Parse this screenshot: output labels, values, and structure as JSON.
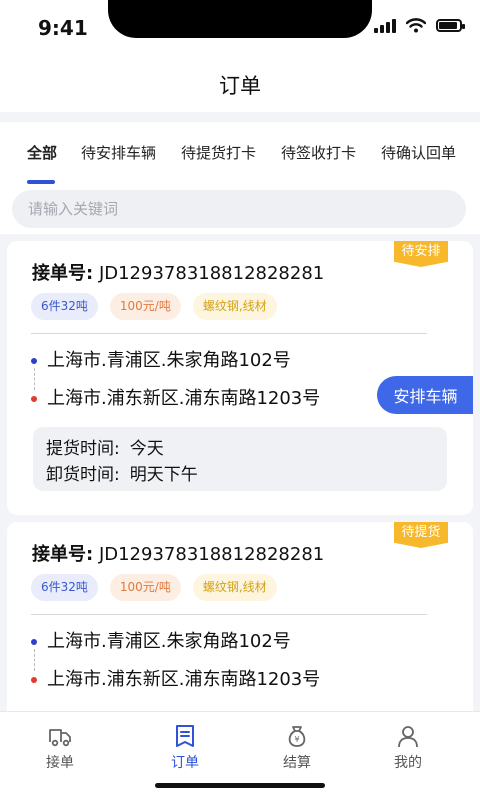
{
  "status_bar": {
    "time": "9:41"
  },
  "header": {
    "title": "订单"
  },
  "tabs": [
    {
      "label": "全部",
      "active": true
    },
    {
      "label": "待安排车辆",
      "active": false
    },
    {
      "label": "待提货打卡",
      "active": false
    },
    {
      "label": "待签收打卡",
      "active": false
    },
    {
      "label": "待确认回单",
      "active": false
    }
  ],
  "search": {
    "placeholder": "请输入关键词",
    "value": ""
  },
  "orders": [
    {
      "status": "待安排",
      "order_label": "接单号:",
      "order_no": "JD129378318812828281",
      "tags": {
        "quantity": "6件32吨",
        "price": "100元/吨",
        "cargo": "螺纹钢,线材"
      },
      "from": "上海市.青浦区.朱家角路102号",
      "to": "上海市.浦东新区.浦东南路1203号",
      "pickup_label": "提货时间:",
      "pickup_value": "今天",
      "unload_label": "卸货时间:",
      "unload_value": "明天下午",
      "action": "安排车辆"
    },
    {
      "status": "待提货",
      "order_label": "接单号:",
      "order_no": "JD129378318812828281",
      "tags": {
        "quantity": "6件32吨",
        "price": "100元/吨",
        "cargo": "螺纹钢,线材"
      },
      "from": "上海市.青浦区.朱家角路102号",
      "to": "上海市.浦东新区.浦东南路1203号"
    }
  ],
  "bottom_nav": [
    {
      "label": "接单",
      "icon": "truck-icon",
      "active": false
    },
    {
      "label": "订单",
      "icon": "order-list-icon",
      "active": true
    },
    {
      "label": "结算",
      "icon": "money-bag-icon",
      "active": false
    },
    {
      "label": "我的",
      "icon": "user-icon",
      "active": false
    }
  ],
  "colors": {
    "accent": "#2f52d6",
    "button": "#3f68e8",
    "status_badge": "#f7b82b"
  }
}
